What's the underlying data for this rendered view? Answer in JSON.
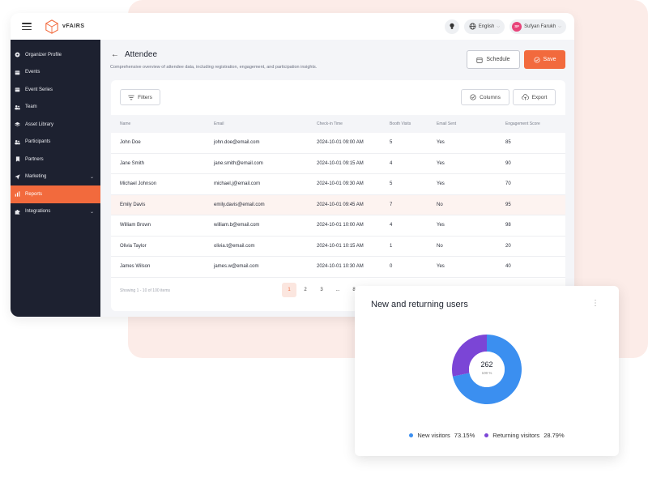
{
  "topbar": {
    "logo_text": "vFAIRS",
    "language": "English",
    "user_initials": "SF",
    "user_name": "Sufyan Farukh"
  },
  "sidebar": {
    "items": [
      {
        "label": "Organizer Profile",
        "icon": "gear-icon"
      },
      {
        "label": "Events",
        "icon": "calendar-icon"
      },
      {
        "label": "Event Series",
        "icon": "calendar-icon"
      },
      {
        "label": "Team",
        "icon": "team-icon"
      },
      {
        "label": "Asset Library",
        "icon": "layers-icon"
      },
      {
        "label": "Participants",
        "icon": "users-icon"
      },
      {
        "label": "Partners",
        "icon": "bookmark-icon"
      },
      {
        "label": "Marketing",
        "icon": "send-icon"
      },
      {
        "label": "Reports",
        "icon": "bar-chart-icon"
      },
      {
        "label": "Integrations",
        "icon": "puzzle-icon"
      }
    ]
  },
  "page": {
    "title": "Attendee",
    "subtitle": "Comprehensive overview of attendee data, including registration, engagement, and participation insights.",
    "schedule_label": "Schedule",
    "save_label": "Save"
  },
  "toolbar": {
    "filters_label": "Filters",
    "columns_label": "Columns",
    "export_label": "Export"
  },
  "table": {
    "headers": [
      "Name",
      "Email",
      "Check-in Time",
      "Booth Visits",
      "Email Sent",
      "Engagement Score"
    ],
    "rows": [
      [
        "John Doe",
        "john.doe@email.com",
        "2024-10-01 09:00 AM",
        "5",
        "Yes",
        "85"
      ],
      [
        "Jane Smith",
        "jane.smith@email.com",
        "2024-10-01 09:15 AM",
        "4",
        "Yes",
        "90"
      ],
      [
        "Michael Johnson",
        "michael.j@email.com",
        "2024-10-01 09:30 AM",
        "5",
        "Yes",
        "70"
      ],
      [
        "Emily Davis",
        "emily.davis@email.com",
        "2024-10-01 09:45 AM",
        "7",
        "No",
        "95"
      ],
      [
        "William Brown",
        "william.b@email.com",
        "2024-10-01 10:00 AM",
        "4",
        "Yes",
        "98"
      ],
      [
        "Olivia Taylor",
        "olivia.t@email.com",
        "2024-10-01 10:15 AM",
        "1",
        "No",
        "20"
      ],
      [
        "James Wilson",
        "james.w@email.com",
        "2024-10-01 10:30 AM",
        "0",
        "Yes",
        "40"
      ]
    ]
  },
  "pagination": {
    "info": "Showing 1 - 10 of 100 items",
    "pages": [
      "1",
      "2",
      "3",
      "...",
      "8"
    ],
    "active": "1"
  },
  "chart_card": {
    "title": "New and returning users",
    "center_value": "262",
    "center_percent": "100 %"
  },
  "chart_data": {
    "type": "pie",
    "categories": [
      "New visitors",
      "Returning visitors"
    ],
    "values": [
      73.15,
      28.79
    ],
    "value_labels": [
      "73.15%",
      "28.79%"
    ],
    "colors": [
      "#3b8ff0",
      "#7b45d6"
    ],
    "legend": "bottom"
  },
  "colors": {
    "accent": "#f26a3d",
    "sidebar_bg": "#1d2130"
  }
}
